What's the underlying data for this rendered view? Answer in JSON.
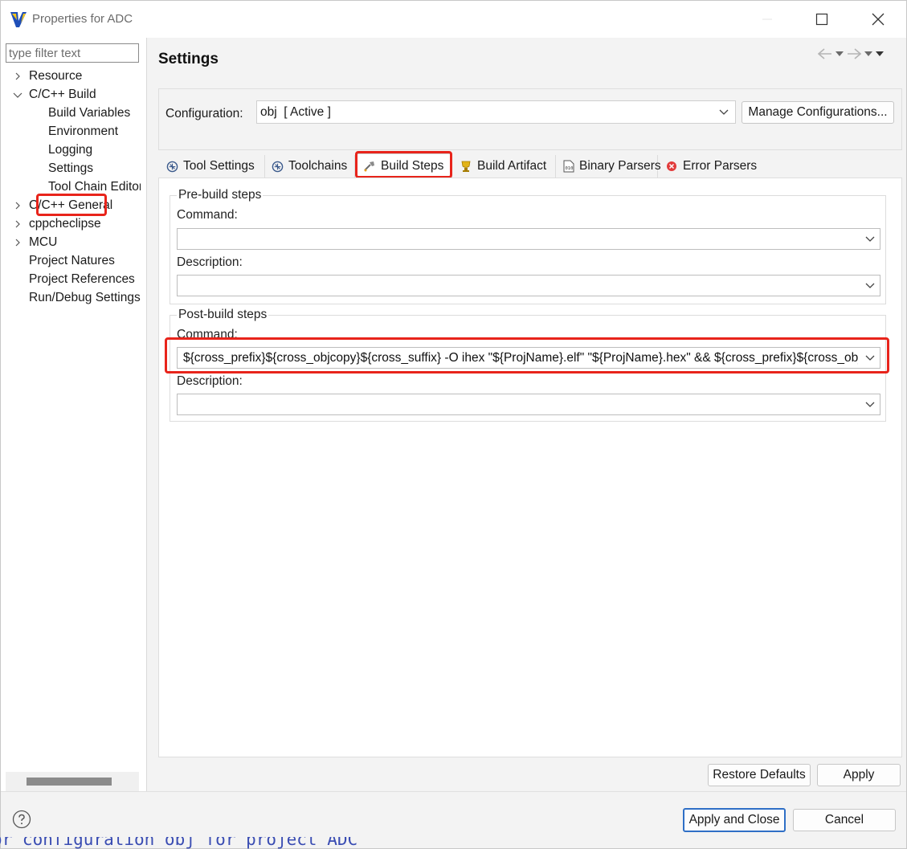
{
  "window": {
    "title": "Properties for ADC",
    "controls": [
      "minimize-icon",
      "maximize-icon",
      "close-icon"
    ]
  },
  "sidebar": {
    "filter_placeholder": "type filter text",
    "items": [
      {
        "label": "Resource",
        "twisty": "collapsed"
      },
      {
        "label": "C/C++ Build",
        "twisty": "expanded"
      },
      {
        "label": "Build Variables"
      },
      {
        "label": "Environment"
      },
      {
        "label": "Logging"
      },
      {
        "label": "Settings",
        "selected": true
      },
      {
        "label": "Tool Chain Editor"
      },
      {
        "label": "C/C++ General",
        "twisty": "collapsed"
      },
      {
        "label": "cppcheclipse",
        "twisty": "collapsed"
      },
      {
        "label": "MCU",
        "twisty": "collapsed"
      },
      {
        "label": "Project Natures"
      },
      {
        "label": "Project References"
      },
      {
        "label": "Run/Debug Settings"
      }
    ]
  },
  "main": {
    "title": "Settings",
    "configuration": {
      "label": "Configuration:",
      "value": "obj  [ Active ]",
      "manage_button": "Manage Configurations..."
    },
    "tabs": [
      {
        "label": "Tool Settings",
        "icon": "tool-settings-icon"
      },
      {
        "label": "Toolchains",
        "icon": "toolchains-icon"
      },
      {
        "label": "Build Steps",
        "icon": "build-steps-icon",
        "active": true
      },
      {
        "label": "Build Artifact",
        "icon": "build-artifact-icon"
      },
      {
        "label": "Binary Parsers",
        "icon": "binary-parsers-icon"
      },
      {
        "label": "Error Parsers",
        "icon": "error-parsers-icon"
      }
    ],
    "pre_build": {
      "legend": "Pre-build steps",
      "command_label": "Command:",
      "command_value": "",
      "description_label": "Description:",
      "description_value": ""
    },
    "post_build": {
      "legend": "Post-build steps",
      "command_label": "Command:",
      "command_value": "${cross_prefix}${cross_objcopy}${cross_suffix} -O ihex \"${ProjName}.elf\" \"${ProjName}.hex\" && ${cross_prefix}${cross_objcopy}${cross_suffix} -O binary \"${ProjName}.elf\" \"${ProjName}.bin\"",
      "description_label": "Description:",
      "description_value": ""
    },
    "restore_defaults_button": "Restore Defaults",
    "apply_button": "Apply"
  },
  "footer": {
    "apply_close_button": "Apply and Close",
    "cancel_button": "Cancel"
  },
  "background_console_text": "or configuration obj for project ADC",
  "colors": {
    "highlight": "#e8241b",
    "default_button_border": "#2f6fc6",
    "console_text": "#3a4db3"
  }
}
